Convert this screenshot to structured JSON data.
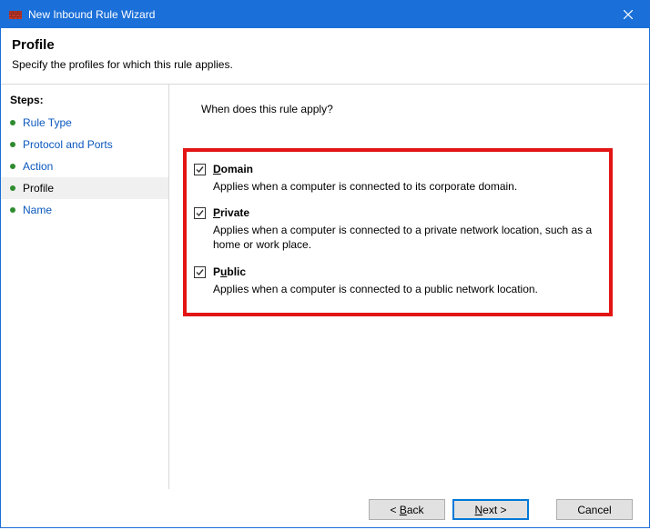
{
  "titlebar": {
    "title": "New Inbound Rule Wizard"
  },
  "header": {
    "title": "Profile",
    "description": "Specify the profiles for which this rule applies."
  },
  "sidebar": {
    "heading": "Steps:",
    "items": [
      {
        "label": "Rule Type",
        "current": false
      },
      {
        "label": "Protocol and Ports",
        "current": false
      },
      {
        "label": "Action",
        "current": false
      },
      {
        "label": "Profile",
        "current": true
      },
      {
        "label": "Name",
        "current": false
      }
    ]
  },
  "main": {
    "question": "When does this rule apply?",
    "options": [
      {
        "key": "domain",
        "accel": "D",
        "rest": "omain",
        "checked": true,
        "desc": "Applies when a computer is connected to its corporate domain."
      },
      {
        "key": "private",
        "accel": "P",
        "rest": "rivate",
        "checked": true,
        "desc": "Applies when a computer is connected to a private network location, such as a home or work place."
      },
      {
        "key": "public",
        "accel": "u",
        "pre": "P",
        "rest": "blic",
        "checked": true,
        "desc": "Applies when a computer is connected to a public network location."
      }
    ]
  },
  "footer": {
    "back_pre": "< ",
    "back_accel": "B",
    "back_rest": "ack",
    "next_accel": "N",
    "next_rest": "ext >",
    "cancel": "Cancel"
  }
}
